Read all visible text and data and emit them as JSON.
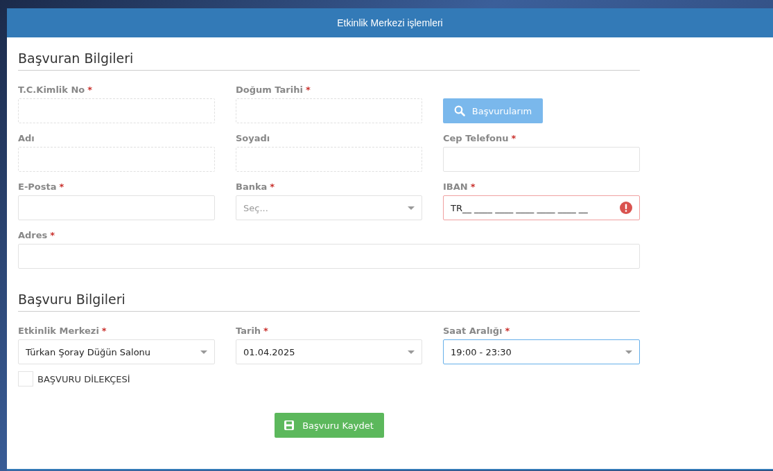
{
  "window": {
    "title": "Etkinlik Merkezi işlemleri"
  },
  "sections": [
    {
      "title": "Başvuran Bilgileri",
      "fields": [
        {
          "kind": "input",
          "label": "T.C.Kimlik No",
          "required_mark": "*",
          "disabled": true,
          "error": false
        },
        {
          "kind": "input",
          "label": "Doğum Tarihi",
          "required_mark": "*",
          "disabled": true,
          "error": false
        },
        {
          "kind": "button",
          "label": "Başvurularım"
        },
        {
          "kind": "input",
          "label": "Adı",
          "disabled": true,
          "error": false
        },
        {
          "kind": "input",
          "label": "Soyadı",
          "disabled": true,
          "error": false
        },
        {
          "kind": "input",
          "label": "Cep Telefonu",
          "required_mark": "*",
          "disabled": false,
          "error": false
        },
        {
          "kind": "input",
          "label": "E-Posta",
          "required_mark": "*",
          "disabled": false,
          "error": false
        },
        {
          "kind": "select",
          "label": "Banka",
          "required_mark": "*",
          "placeholder": "Seç...",
          "focused": false
        },
        {
          "kind": "input",
          "label": "IBAN",
          "required_mark": "*",
          "disabled": false,
          "error": true,
          "value": "TR__ ____ ____ ____ ____ ____ __"
        },
        {
          "kind": "wide",
          "label": "Adres",
          "required_mark": "*",
          "disabled": false,
          "error": false
        }
      ]
    },
    {
      "title": "Başvuru Bilgileri",
      "fields": [
        {
          "kind": "select",
          "label": "Etkinlik Merkezi",
          "required_mark": "*",
          "value": "Türkan Şoray Düğün Salonu",
          "focused": false
        },
        {
          "kind": "select",
          "label": "Tarih",
          "required_mark": "*",
          "value": "01.04.2025",
          "focused": false
        },
        {
          "kind": "select",
          "label": "Saat Aralığı",
          "required_mark": "*",
          "value": "19:00 - 23:30",
          "focused": true
        }
      ],
      "checkbox": {
        "label": "BAŞVURU DİLEKÇESİ",
        "checked": false
      }
    }
  ],
  "submit": {
    "label": "Başvuru Kaydet"
  }
}
